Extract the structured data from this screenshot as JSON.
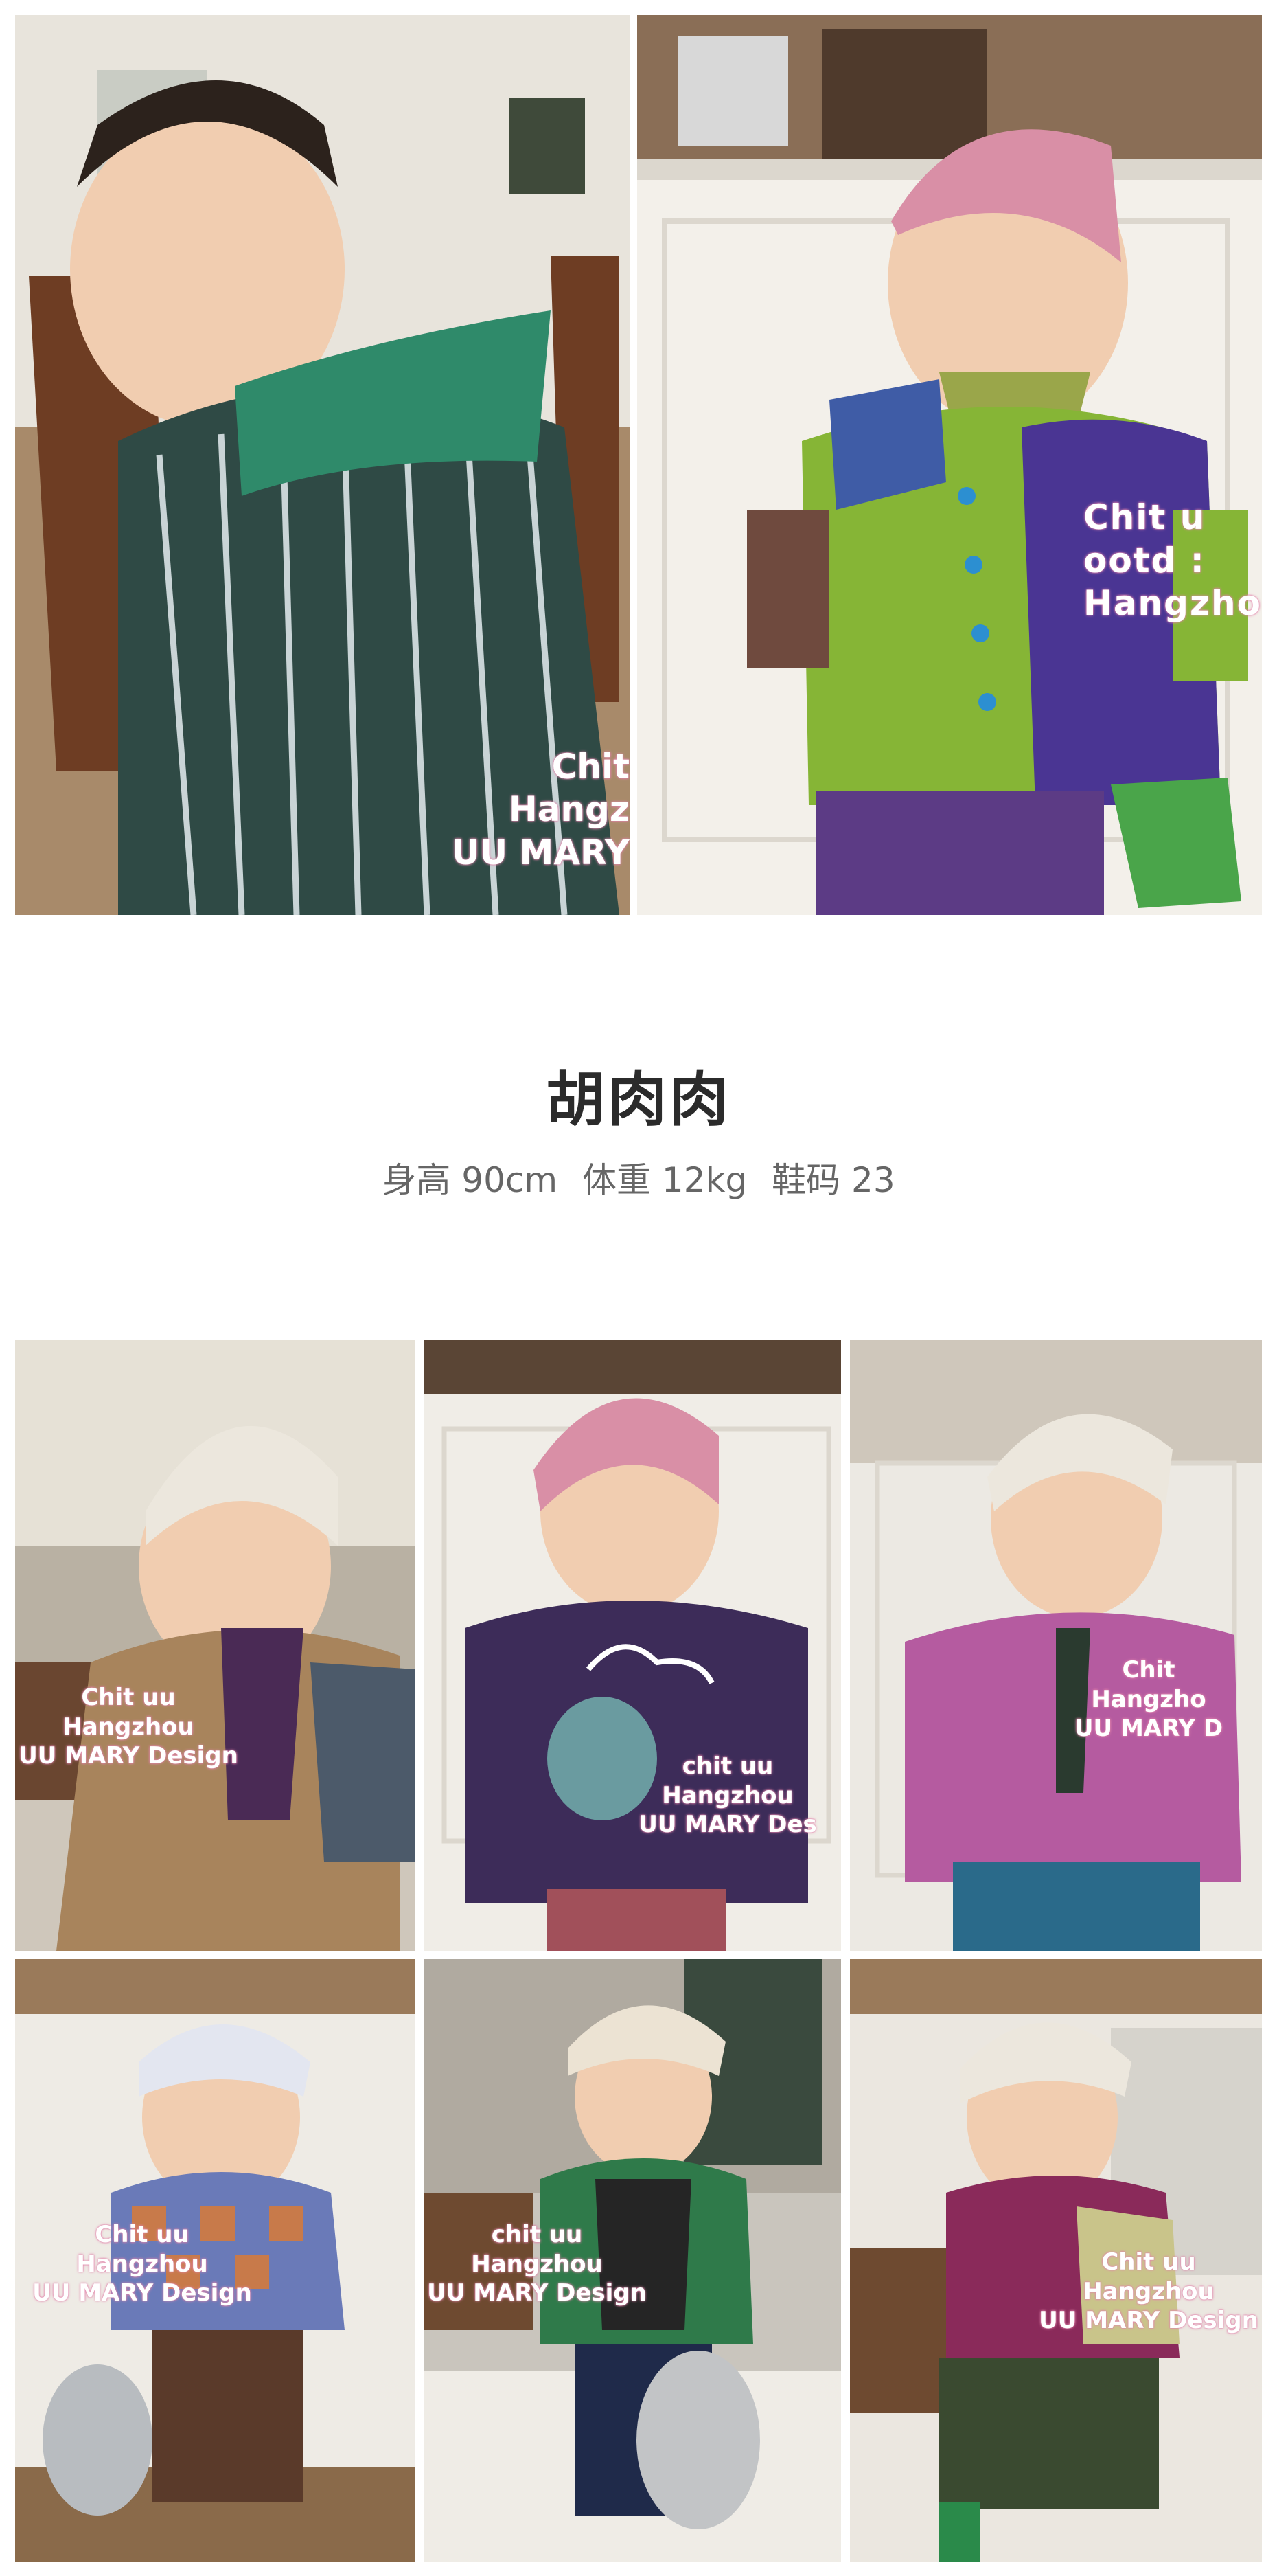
{
  "profile": {
    "name": "胡肉肉",
    "height": "身高 90cm",
    "weight": "体重 12kg",
    "shoe_size": "鞋码 23"
  },
  "watermarks": {
    "photo1": [
      "Chit",
      "Hangz",
      "UU MARY"
    ],
    "photo2": [
      "Chit  u",
      "ootd :",
      "Hangzho"
    ],
    "photo3": [
      "Chit  uu",
      "Hangzhou",
      "UU MARY Design"
    ],
    "photo4": [
      "chit uu",
      "Hangzhou",
      "UU MARY Des"
    ],
    "photo5": [
      "Chit",
      "Hangzho",
      "UU MARY D"
    ],
    "photo6": [
      "Chit  uu",
      "Hangzhou",
      "UU MARY Design"
    ],
    "photo7": [
      "chit uu",
      "Hangzhou",
      "UU MARY Design"
    ],
    "photo8": [
      "Chit  uu",
      "Hangzhou",
      "UU MARY Design"
    ]
  },
  "colors": {
    "page_bg": "#ffffff",
    "title_text": "#2b2b2b",
    "info_text": "#666666",
    "watermark_glow": "#e68fb3"
  }
}
